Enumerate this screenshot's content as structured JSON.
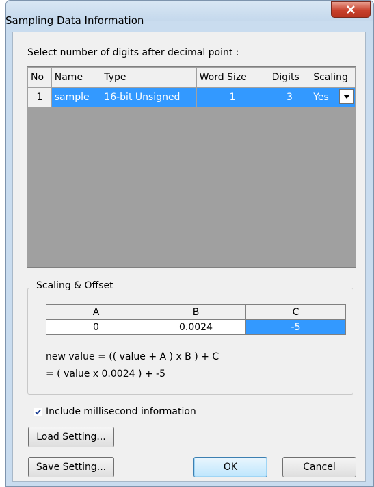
{
  "window": {
    "title": "Sampling Data Information",
    "close_label": "X"
  },
  "instruction": "Select number of digits after decimal point :",
  "grid": {
    "headers": [
      "No",
      "Name",
      "Type",
      "Word Size",
      "Digits",
      "Scaling"
    ],
    "rows": [
      {
        "no": "1",
        "name": "sample",
        "type": "16-bit Unsigned",
        "word_size": "1",
        "digits": "3",
        "scaling": "Yes"
      }
    ]
  },
  "scaling_offset": {
    "label": "Scaling & Offset",
    "headers": [
      "A",
      "B",
      "C"
    ],
    "values": [
      "0",
      "0.0024",
      "-5"
    ],
    "formula_line1": "new value = (( value + A ) x B ) + C",
    "formula_line2": "= ( value x 0.0024 ) + -5"
  },
  "include_ms": {
    "label": "Include millisecond information",
    "checked": true
  },
  "buttons": {
    "load": "Load Setting...",
    "save": "Save Setting...",
    "ok": "OK",
    "cancel": "Cancel"
  },
  "colors": {
    "selection": "#3399ff",
    "grid_background": "#a0a0a0",
    "close_button": "#c8412d"
  }
}
